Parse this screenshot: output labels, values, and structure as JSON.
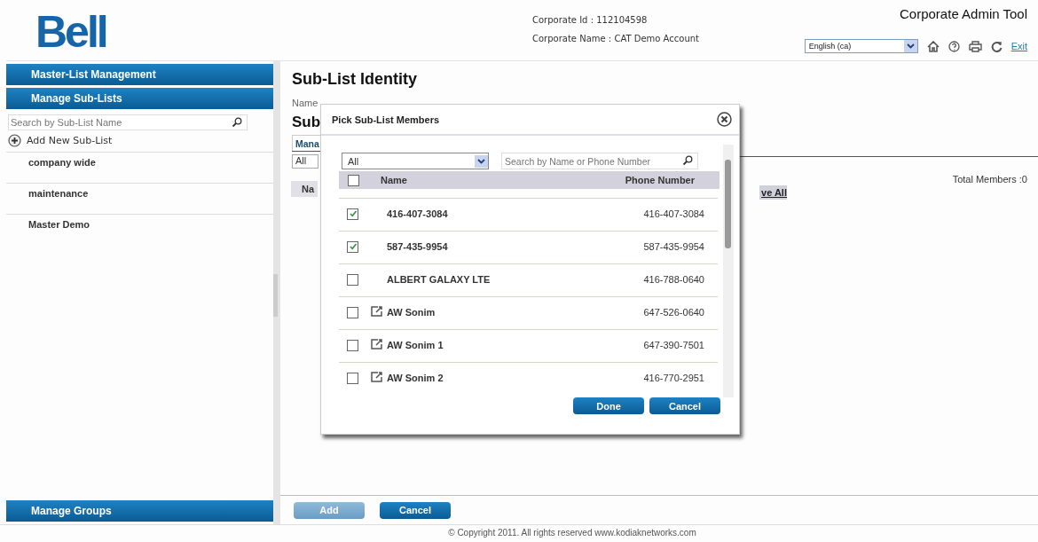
{
  "header": {
    "logo": "Bell",
    "corporate_id": "Corporate Id : 112104598",
    "corporate_name": "Corporate Name : CAT Demo Account",
    "app_title": "Corporate Admin Tool",
    "language": "English (ca)",
    "exit": "Exit"
  },
  "sidebar": {
    "sections": [
      {
        "label": "Master-List Management"
      },
      {
        "label": "Manage Sub-Lists"
      }
    ],
    "search": {
      "placeholder": "Search by Sub-List Name"
    },
    "add_label": "Add New Sub-List",
    "items": [
      {
        "label": "company wide"
      },
      {
        "label": "maintenance"
      },
      {
        "label": "Master Demo"
      }
    ],
    "bottom_section": "Manage Groups"
  },
  "main": {
    "title": "Sub-List Identity",
    "name_label": "Name",
    "section_title": "Sub",
    "tab": "Mana",
    "filter": "All",
    "column_1": "Na",
    "remove_link": "ve All",
    "total": "Total Members :0",
    "buttons": [
      {
        "label": "Add",
        "disabled": true
      },
      {
        "label": "Cancel",
        "disabled": false
      }
    ]
  },
  "dialog": {
    "title": "Pick Sub-List Members",
    "filter": "All",
    "search": {
      "placeholder": "Search by Name or Phone Number"
    },
    "select_all": {
      "checked": false
    },
    "columns": [
      "Name",
      "Phone Number"
    ],
    "rows": [
      {
        "name": "416-407-3084",
        "phone": "416-407-3084",
        "checked": true,
        "kind": "contact"
      },
      {
        "name": "587-435-9954",
        "phone": "587-435-9954",
        "checked": true,
        "kind": "contact"
      },
      {
        "name": "ALBERT GALAXY LTE",
        "phone": "416-788-0640",
        "checked": false,
        "kind": "contact"
      },
      {
        "name": "AW Sonim",
        "phone": "647-526-0640",
        "checked": false,
        "kind": "device"
      },
      {
        "name": "AW Sonim 1",
        "phone": "647-390-7501",
        "checked": false,
        "kind": "device"
      },
      {
        "name": "AW Sonim 2",
        "phone": "416-770-2951",
        "checked": false,
        "kind": "device"
      }
    ],
    "buttons": [
      "Done",
      "Cancel"
    ]
  },
  "footer": "© Copyright 2011. All rights reserved www.kodiaknetworks.com"
}
